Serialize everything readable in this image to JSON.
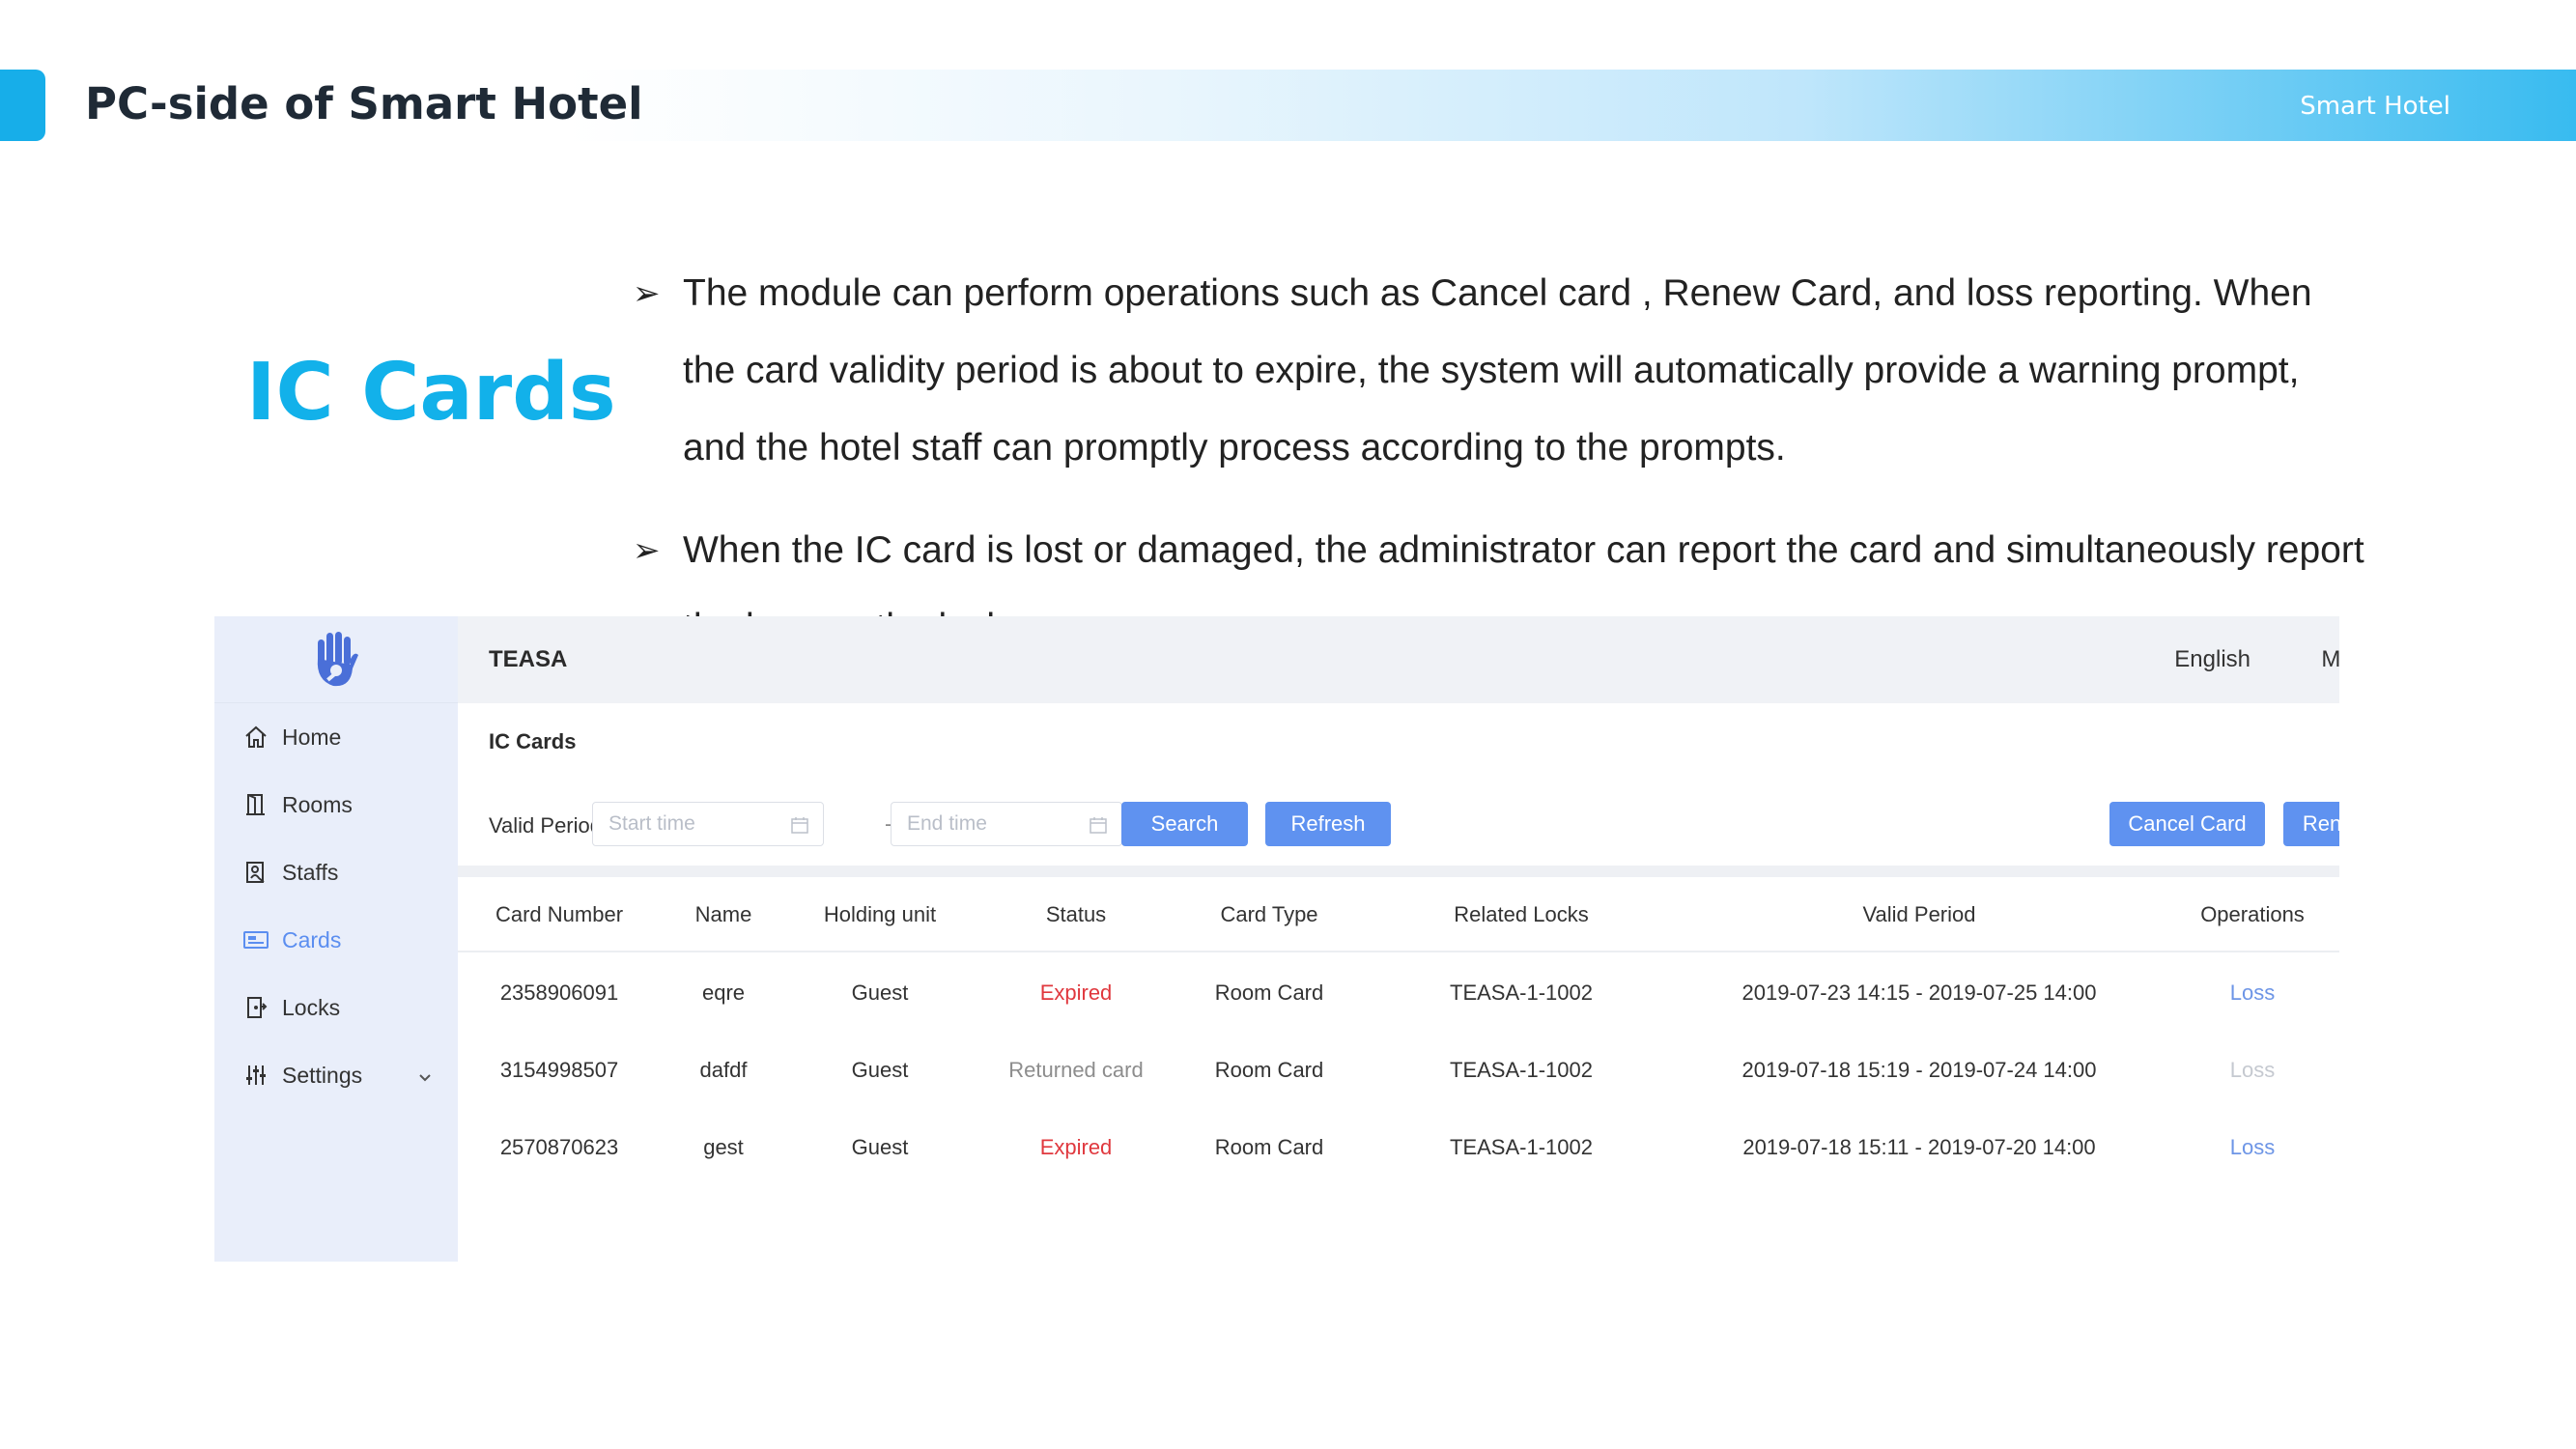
{
  "slide": {
    "title": "PC-side of Smart Hotel",
    "tag": "Smart Hotel",
    "heading": "IC Cards",
    "bullets": [
      "The module can perform operations such as Cancel card , Renew Card, and loss reporting. When the card validity period is about to expire, the system will automatically provide a warning prompt, and the hotel staff can promptly process according to the prompts.",
      "When the IC card is lost or damaged, the administrator can report the card and simultaneously report the loss on the lock."
    ]
  },
  "app": {
    "brand": "TEASA",
    "language": "English",
    "user": "MRLIU",
    "sidebar": {
      "items": [
        {
          "label": "Home",
          "icon": "home-icon"
        },
        {
          "label": "Rooms",
          "icon": "door-icon"
        },
        {
          "label": "Staffs",
          "icon": "staff-badge-icon"
        },
        {
          "label": "Cards",
          "icon": "card-icon",
          "active": true
        },
        {
          "label": "Locks",
          "icon": "lock-icon"
        },
        {
          "label": "Settings",
          "icon": "sliders-icon",
          "expandable": true
        }
      ]
    },
    "page_title": "IC Cards",
    "filter": {
      "label": "Valid Period:",
      "start_placeholder": "Start time",
      "end_placeholder": "End time",
      "separator": "-",
      "search_label": "Search",
      "refresh_label": "Refresh",
      "cancel_card_label": "Cancel Card",
      "renew_card_label": "Renew Card"
    },
    "table": {
      "columns": [
        "Card Number",
        "Name",
        "Holding unit",
        "Status",
        "Card Type",
        "Related Locks",
        "Valid Period",
        "Operations"
      ],
      "rows": [
        {
          "card_number": "2358906091",
          "name": "eqre",
          "holding_unit": "Guest",
          "status": "Expired",
          "status_kind": "expired",
          "card_type": "Room Card",
          "related_locks": "TEASA-1-1002",
          "valid_period": "2019-07-23 14:15 - 2019-07-25 14:00",
          "operation": "Loss",
          "operation_enabled": true
        },
        {
          "card_number": "3154998507",
          "name": "dafdf",
          "holding_unit": "Guest",
          "status": "Returned card",
          "status_kind": "returned",
          "card_type": "Room Card",
          "related_locks": "TEASA-1-1002",
          "valid_period": "2019-07-18 15:19 - 2019-07-24 14:00",
          "operation": "Loss",
          "operation_enabled": false
        },
        {
          "card_number": "2570870623",
          "name": "gest",
          "holding_unit": "Guest",
          "status": "Expired",
          "status_kind": "expired",
          "card_type": "Room Card",
          "related_locks": "TEASA-1-1002",
          "valid_period": "2019-07-18 15:11 - 2019-07-20 14:00",
          "operation": "Loss",
          "operation_enabled": true
        }
      ]
    },
    "colors": {
      "accent": "#5f92f0",
      "heading": "#12b1ea",
      "expired": "#e0383e",
      "sidebar_bg": "#e9eefa"
    }
  }
}
